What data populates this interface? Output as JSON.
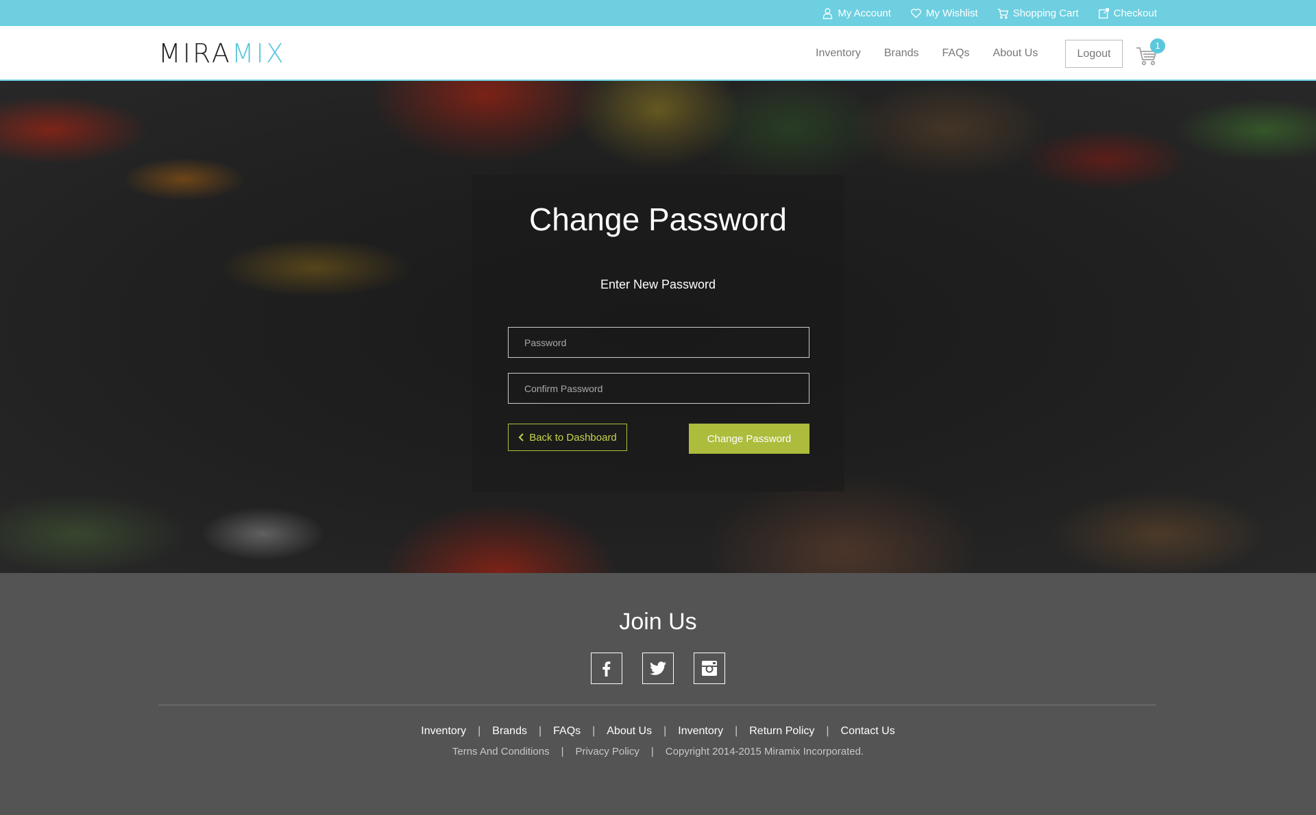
{
  "topbar": {
    "links": [
      {
        "label": "My Account",
        "icon": "user-icon"
      },
      {
        "label": "My Wishlist",
        "icon": "heart-icon"
      },
      {
        "label": "Shopping Cart",
        "icon": "cart-icon"
      },
      {
        "label": "Checkout",
        "icon": "checkout-icon"
      }
    ]
  },
  "header": {
    "logo_dark": "MIRA",
    "logo_light": "MIX",
    "nav": [
      "Inventory",
      "Brands",
      "FAQs",
      "About Us"
    ],
    "logout_label": "Logout",
    "cart_count": "1"
  },
  "form": {
    "title": "Change Password",
    "subtitle": "Enter New Password",
    "password_placeholder": "Password",
    "confirm_placeholder": "Confirm Password",
    "back_label": "Back to Dashboard",
    "submit_label": "Change Password"
  },
  "footer": {
    "join_title": "Join Us",
    "social": [
      "facebook-icon",
      "twitter-icon",
      "instagram-icon"
    ],
    "links": [
      "Inventory",
      "Brands",
      "FAQs",
      "About Us",
      "Inventory",
      "Return Policy",
      "Contact Us"
    ],
    "legal": [
      "Terns And Conditions",
      "Privacy Policy",
      "Copyright 2014-2015 Miramix Incorporated."
    ]
  },
  "colors": {
    "accent_blue": "#6dcfe0",
    "accent_green": "#adbc3c",
    "footer_bg": "#545454"
  }
}
